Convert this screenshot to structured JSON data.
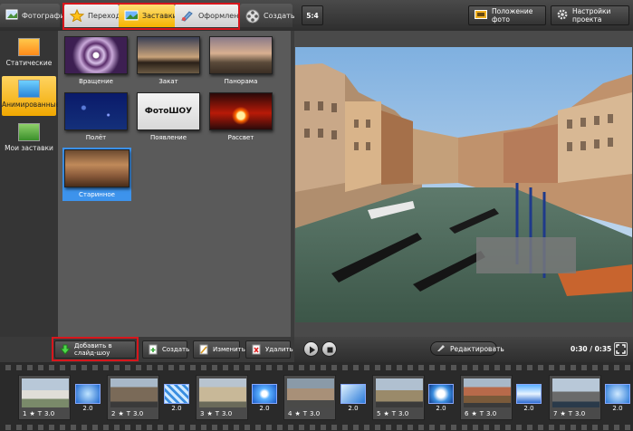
{
  "tabs": [
    {
      "label": "Фотографии",
      "icon": "photo-icon"
    },
    {
      "label": "Переходы",
      "icon": "star-icon"
    },
    {
      "label": "Заставки",
      "icon": "picture-icon"
    },
    {
      "label": "Оформление",
      "icon": "brush-icon"
    },
    {
      "label": "Создать",
      "icon": "film-reel-icon"
    }
  ],
  "categories": [
    {
      "label": "Статические"
    },
    {
      "label": "Анимированные"
    },
    {
      "label": "Мои заставки"
    }
  ],
  "tiles": [
    {
      "label": "Вращение"
    },
    {
      "label": "Закат"
    },
    {
      "label": "Панорама"
    },
    {
      "label": "Полёт"
    },
    {
      "label": "Появление",
      "overlay": "ФотоШОУ"
    },
    {
      "label": "Рассвет"
    },
    {
      "label": "Старинное"
    }
  ],
  "actions": {
    "add": "Добавить в слайд-шоу",
    "create": "Создать",
    "edit": "Изменить",
    "delete": "Удалить"
  },
  "right_toolbar": {
    "ratio": "5:4",
    "photo_position": "Положение фото",
    "project_settings": "Настройки проекта"
  },
  "player": {
    "edit": "Редактировать",
    "time": "0:30 / 0:35"
  },
  "timeline": {
    "slides": [
      {
        "num": "1",
        "dur": "3.0"
      },
      {
        "num": "2",
        "dur": "3.0"
      },
      {
        "num": "3",
        "dur": "3.0"
      },
      {
        "num": "4",
        "dur": "3.0"
      },
      {
        "num": "5",
        "dur": "3.0"
      },
      {
        "num": "6",
        "dur": "3.0"
      },
      {
        "num": "7",
        "dur": "3.0"
      }
    ],
    "transitions": [
      "2.0",
      "2.0",
      "2.0",
      "2.0",
      "2.0",
      "2.0",
      "2.0"
    ]
  },
  "colors": {
    "accent": "#f5b300",
    "selected_tile": "#3d93ec",
    "highlight_frame": "#d8161c"
  }
}
